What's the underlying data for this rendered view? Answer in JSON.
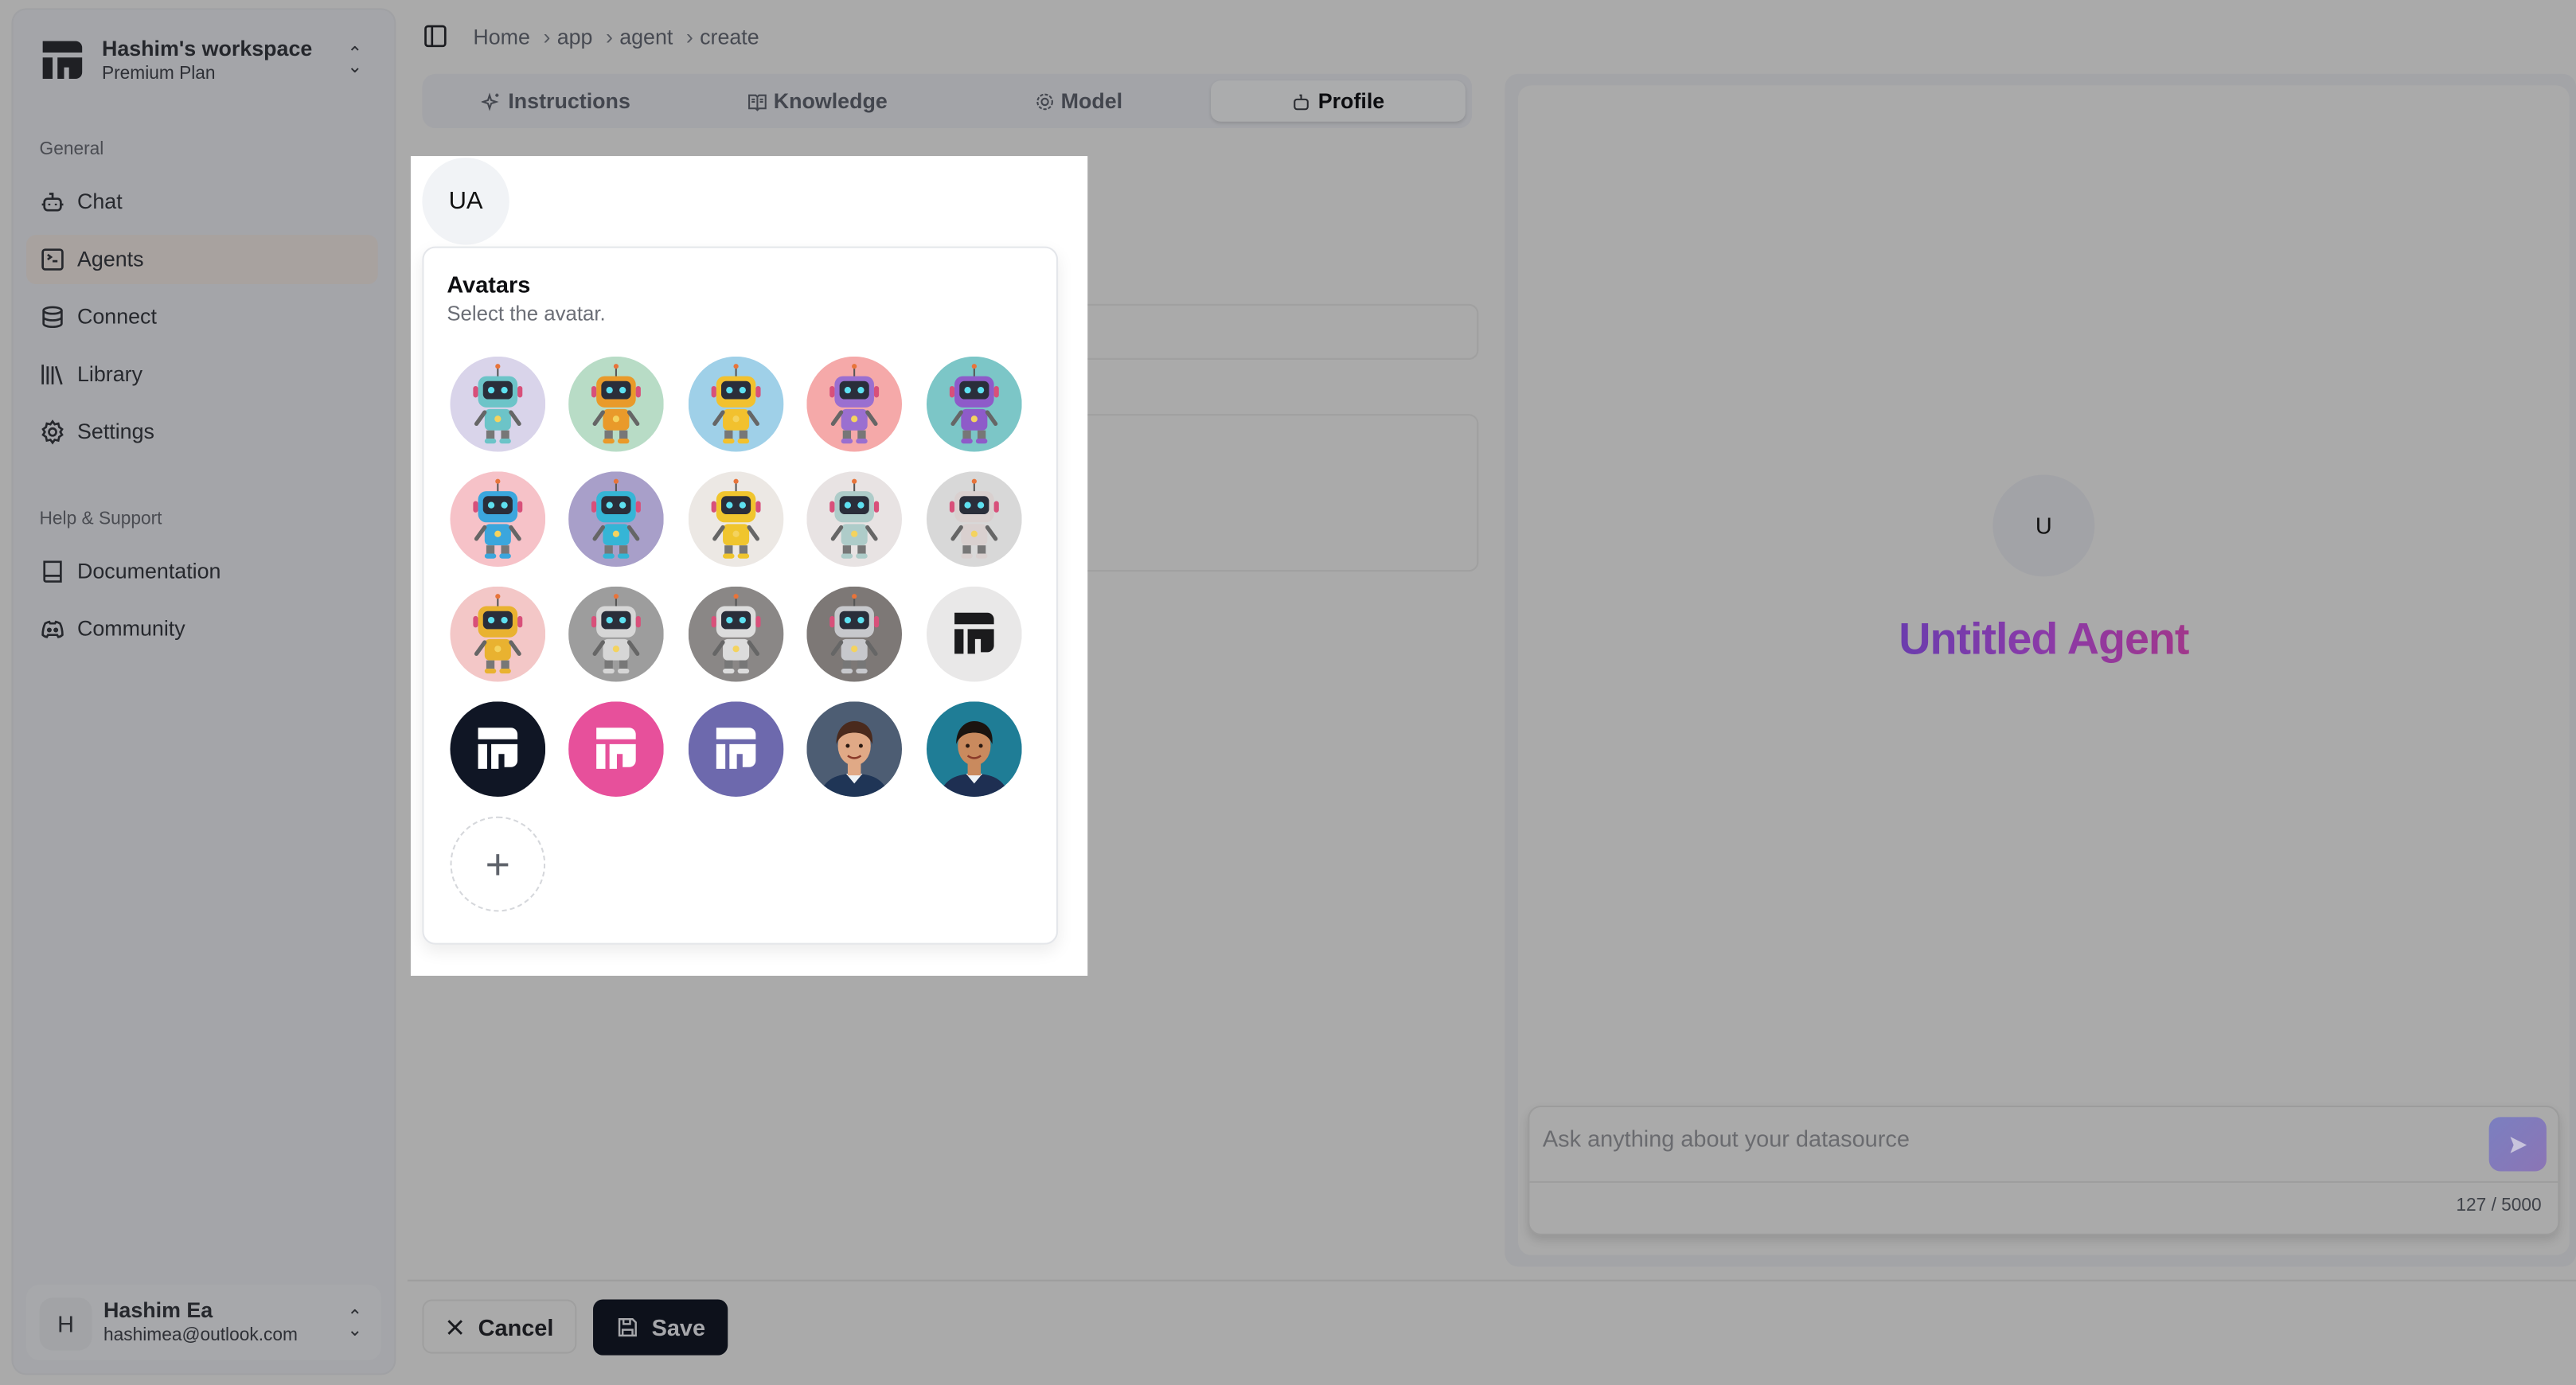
{
  "workspace": {
    "name": "Hashim's workspace",
    "plan": "Premium Plan"
  },
  "sidebar": {
    "general_label": "General",
    "items": [
      {
        "label": "Chat",
        "icon": "bot-icon"
      },
      {
        "label": "Agents",
        "icon": "terminal-icon",
        "active": true
      },
      {
        "label": "Connect",
        "icon": "database-icon"
      },
      {
        "label": "Library",
        "icon": "library-icon"
      },
      {
        "label": "Settings",
        "icon": "gear-icon"
      }
    ],
    "help_label": "Help & Support",
    "help_items": [
      {
        "label": "Documentation",
        "icon": "book-icon"
      },
      {
        "label": "Community",
        "icon": "discord-icon"
      }
    ]
  },
  "user": {
    "initial": "H",
    "name": "Hashim Ea",
    "email": "hashimea@outlook.com"
  },
  "breadcrumb": [
    "Home",
    "app",
    "agent",
    "create"
  ],
  "tabs": [
    {
      "label": "Instructions",
      "icon": "sparkles-icon"
    },
    {
      "label": "Knowledge",
      "icon": "book-open-icon"
    },
    {
      "label": "Model",
      "icon": "cog-icon"
    },
    {
      "label": "Profile",
      "icon": "bot-icon",
      "active": true
    }
  ],
  "avatar_picker": {
    "current_initials": "UA",
    "title": "Avatars",
    "subtitle": "Select the avatar.",
    "avatars": [
      {
        "kind": "robot",
        "bg": "#d9d4ea",
        "body": "#6cc4c8",
        "label": "robot-teal"
      },
      {
        "kind": "robot",
        "bg": "#b8dcc6",
        "body": "#e99a2a",
        "label": "robot-orange"
      },
      {
        "kind": "robot",
        "bg": "#9fd0e8",
        "body": "#f2c12e",
        "label": "robot-yellow-headphones"
      },
      {
        "kind": "robot",
        "bg": "#f5a9a9",
        "body": "#9a6fd0",
        "label": "robot-purple"
      },
      {
        "kind": "robot",
        "bg": "#7cc6c7",
        "body": "#8e5bc9",
        "label": "robot-purple-screen"
      },
      {
        "kind": "robot",
        "bg": "#f6c2c8",
        "body": "#3ba6dd",
        "label": "robot-blue-pink"
      },
      {
        "kind": "robot",
        "bg": "#a89fc9",
        "body": "#35b5d6",
        "label": "robot-cyan"
      },
      {
        "kind": "robot",
        "bg": "#ece8e4",
        "body": "#f0c52e",
        "label": "robot-yellow-red"
      },
      {
        "kind": "robot",
        "bg": "#e8e3e3",
        "body": "#aeccc9",
        "label": "robot-silver-mint"
      },
      {
        "kind": "robot",
        "bg": "#d8d8d8",
        "body": "#d9d0cf",
        "label": "robot-silver-pink"
      },
      {
        "kind": "robot",
        "bg": "#f3c7c7",
        "body": "#e9b230",
        "label": "robot-neon-ring"
      },
      {
        "kind": "robot",
        "bg": "#9d9d9d",
        "body": "#d6d6d6",
        "label": "robot-grey"
      },
      {
        "kind": "robot",
        "bg": "#8a8786",
        "body": "#dcdcdc",
        "label": "robot-white"
      },
      {
        "kind": "robot",
        "bg": "#7d7876",
        "body": "#c7c8cc",
        "label": "robot-silver"
      },
      {
        "kind": "logo",
        "bg": "#e9e8e8",
        "fg": "#1b1b1d",
        "label": "logo-light"
      },
      {
        "kind": "logo",
        "bg": "#101625",
        "fg": "#ffffff",
        "label": "logo-dark"
      },
      {
        "kind": "logo",
        "bg": "#e7509b",
        "fg": "#ffffff",
        "label": "logo-pink"
      },
      {
        "kind": "logo",
        "bg": "#6d69ad",
        "fg": "#ffffff",
        "label": "logo-purple"
      },
      {
        "kind": "person",
        "bg": "#4d5d73",
        "skin": "#e0a986",
        "hair": "#4a2a1d",
        "shirt": "#1f3556",
        "label": "person-woman"
      },
      {
        "kind": "person",
        "bg": "#1f7d96",
        "skin": "#c98a5e",
        "hair": "#1b1410",
        "shirt": "#1e2f52",
        "label": "person-man"
      }
    ],
    "add_label": "+"
  },
  "preview": {
    "initial": "U",
    "agent_name": "Untitled Agent",
    "chat_placeholder": "Ask anything about your datasource",
    "char_count": "127 / 5000"
  },
  "footer": {
    "cancel_label": "Cancel",
    "save_label": "Save"
  },
  "colors": {
    "overlay": "#aaaaaa",
    "save_bg": "#0d111b",
    "title_gradient": [
      "#4a3fb3",
      "#b8336c"
    ]
  }
}
